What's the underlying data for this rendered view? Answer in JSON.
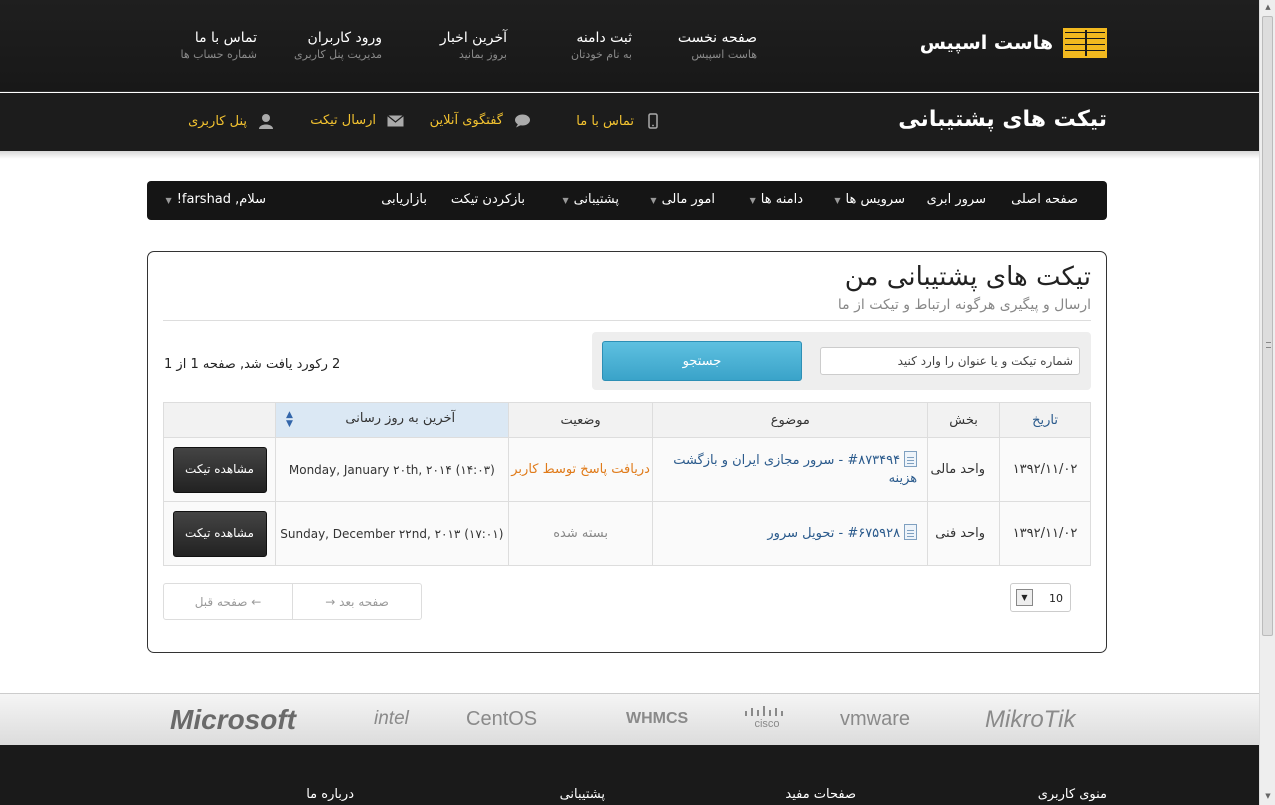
{
  "brand": {
    "name": "هاست اسپیس"
  },
  "top_nav": [
    {
      "title": "صفحه نخست",
      "subtitle": "هاست اسپیس"
    },
    {
      "title": "ثبت دامنه",
      "subtitle": "به نام خودتان"
    },
    {
      "title": "آخرین اخبار",
      "subtitle": "بروز بمانید"
    },
    {
      "title": "ورود کاربران",
      "subtitle": "مدیریت پنل کاربری"
    },
    {
      "title": "تماس با ما",
      "subtitle": "شماره حساب ها"
    }
  ],
  "page_heading": "تیکت های پشتیبانی",
  "quick_links": [
    {
      "label": "تماس با ما",
      "icon": "phone-icon"
    },
    {
      "label": "گفتگوی آنلاین",
      "icon": "chat-icon"
    },
    {
      "label": "ارسال تیکت",
      "icon": "mail-icon"
    },
    {
      "label": "پنل کاربری",
      "icon": "user-icon"
    }
  ],
  "navbar": [
    {
      "label": "صفحه اصلی",
      "dropdown": false
    },
    {
      "label": "سرور ابری",
      "dropdown": false
    },
    {
      "label": "سرویس ها",
      "dropdown": true
    },
    {
      "label": "دامنه ها",
      "dropdown": true
    },
    {
      "label": "امور مالی",
      "dropdown": true
    },
    {
      "label": "پشتیبانی",
      "dropdown": true
    },
    {
      "label": "بازکردن تیکت",
      "dropdown": false
    },
    {
      "label": "بازاریابی",
      "dropdown": false
    },
    {
      "label": "سلام, farshad!",
      "dropdown": true
    }
  ],
  "panel": {
    "title": "تیکت های پشتیبانی من",
    "subtitle": "ارسال و پیگیری هرگونه ارتباط و تیکت از ما",
    "search_placeholder": "شماره تیکت و یا عنوان را وارد کنید",
    "search_button": "جستجو",
    "records_text": "2 رکورد یافت شد, صفحه 1 از 1"
  },
  "table": {
    "headers": {
      "date": "تاریخ",
      "department": "بخش",
      "subject": "موضوع",
      "status": "وضعیت",
      "last_updated": "آخرین به روز رسانی"
    },
    "rows": [
      {
        "date": "۱۳۹۲/۱۱/۰۲",
        "department": "واحد مالی",
        "subject": "#۸۷۳۴۹۴ - سرور مجازی ایران و بازگشت هزینه",
        "status": "دریافت پاسخ توسط کاربر",
        "status_type": "answered",
        "updated": "Monday, January ۲۰th, ۲۰۱۴ (۱۴:۰۳)",
        "action": "مشاهده تیکت"
      },
      {
        "date": "۱۳۹۲/۱۱/۰۲",
        "department": "واحد فنی",
        "subject": "#۶۷۵۹۲۸ - تحویل سرور",
        "status": "بسته شده",
        "status_type": "closed",
        "updated": "Sunday, December ۲۲nd, ۲۰۱۳ (۱۷:۰۱)",
        "action": "مشاهده تیکت"
      }
    ]
  },
  "pagination": {
    "next": "صفحه بعد →",
    "prev": "← صفحه قبل",
    "per_page": "10"
  },
  "partners": [
    "Microsoft",
    "intel",
    "CentOS",
    "WHMCS",
    "cisco",
    "vmware",
    "MikroTik"
  ],
  "footer": [
    "منوی کاربری",
    "صفحات مفید",
    "پشتیبانی",
    "درباره ما"
  ],
  "colors": {
    "accent_yellow": "#f2c230",
    "status_answered": "#e07b1a",
    "button_blue": "#3aa3c9",
    "link_blue": "#2a5a8c"
  }
}
